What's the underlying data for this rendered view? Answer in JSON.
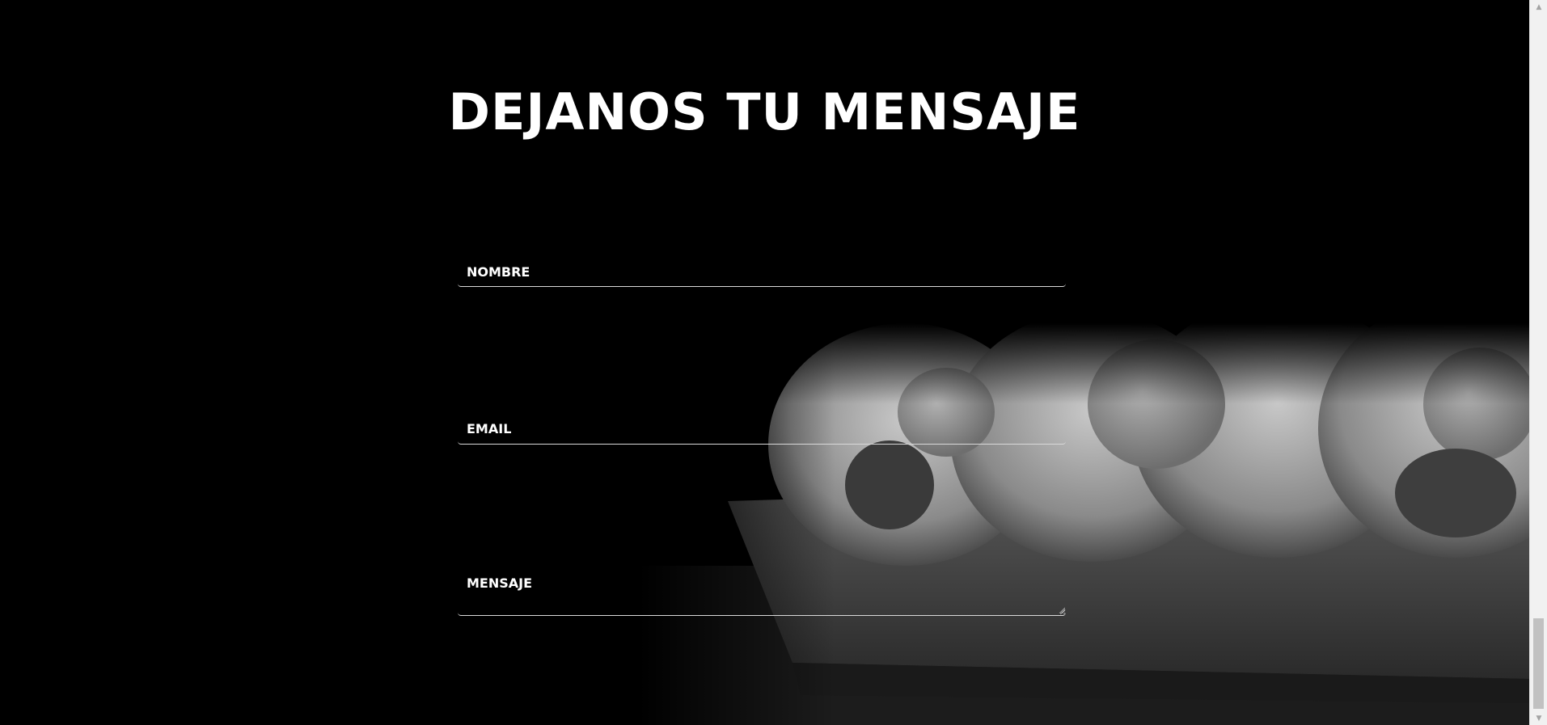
{
  "contact": {
    "title": "DEJANOS TU MENSAJE",
    "name_placeholder": "NOMBRE",
    "email_placeholder": "EMAIL",
    "message_placeholder": "MENSAJE"
  },
  "background_image": {
    "subject": "black and white sushi rolls on wooden board"
  },
  "scrollbar": {
    "up_icon": "arrow-up-icon",
    "down_icon": "arrow-down-icon",
    "position": "bottom"
  },
  "colors": {
    "background": "#000000",
    "text": "#ffffff",
    "field_border": "#d9d9d9",
    "scrollbar_track": "#f1f1f1",
    "scrollbar_thumb": "#c1c1c1"
  }
}
